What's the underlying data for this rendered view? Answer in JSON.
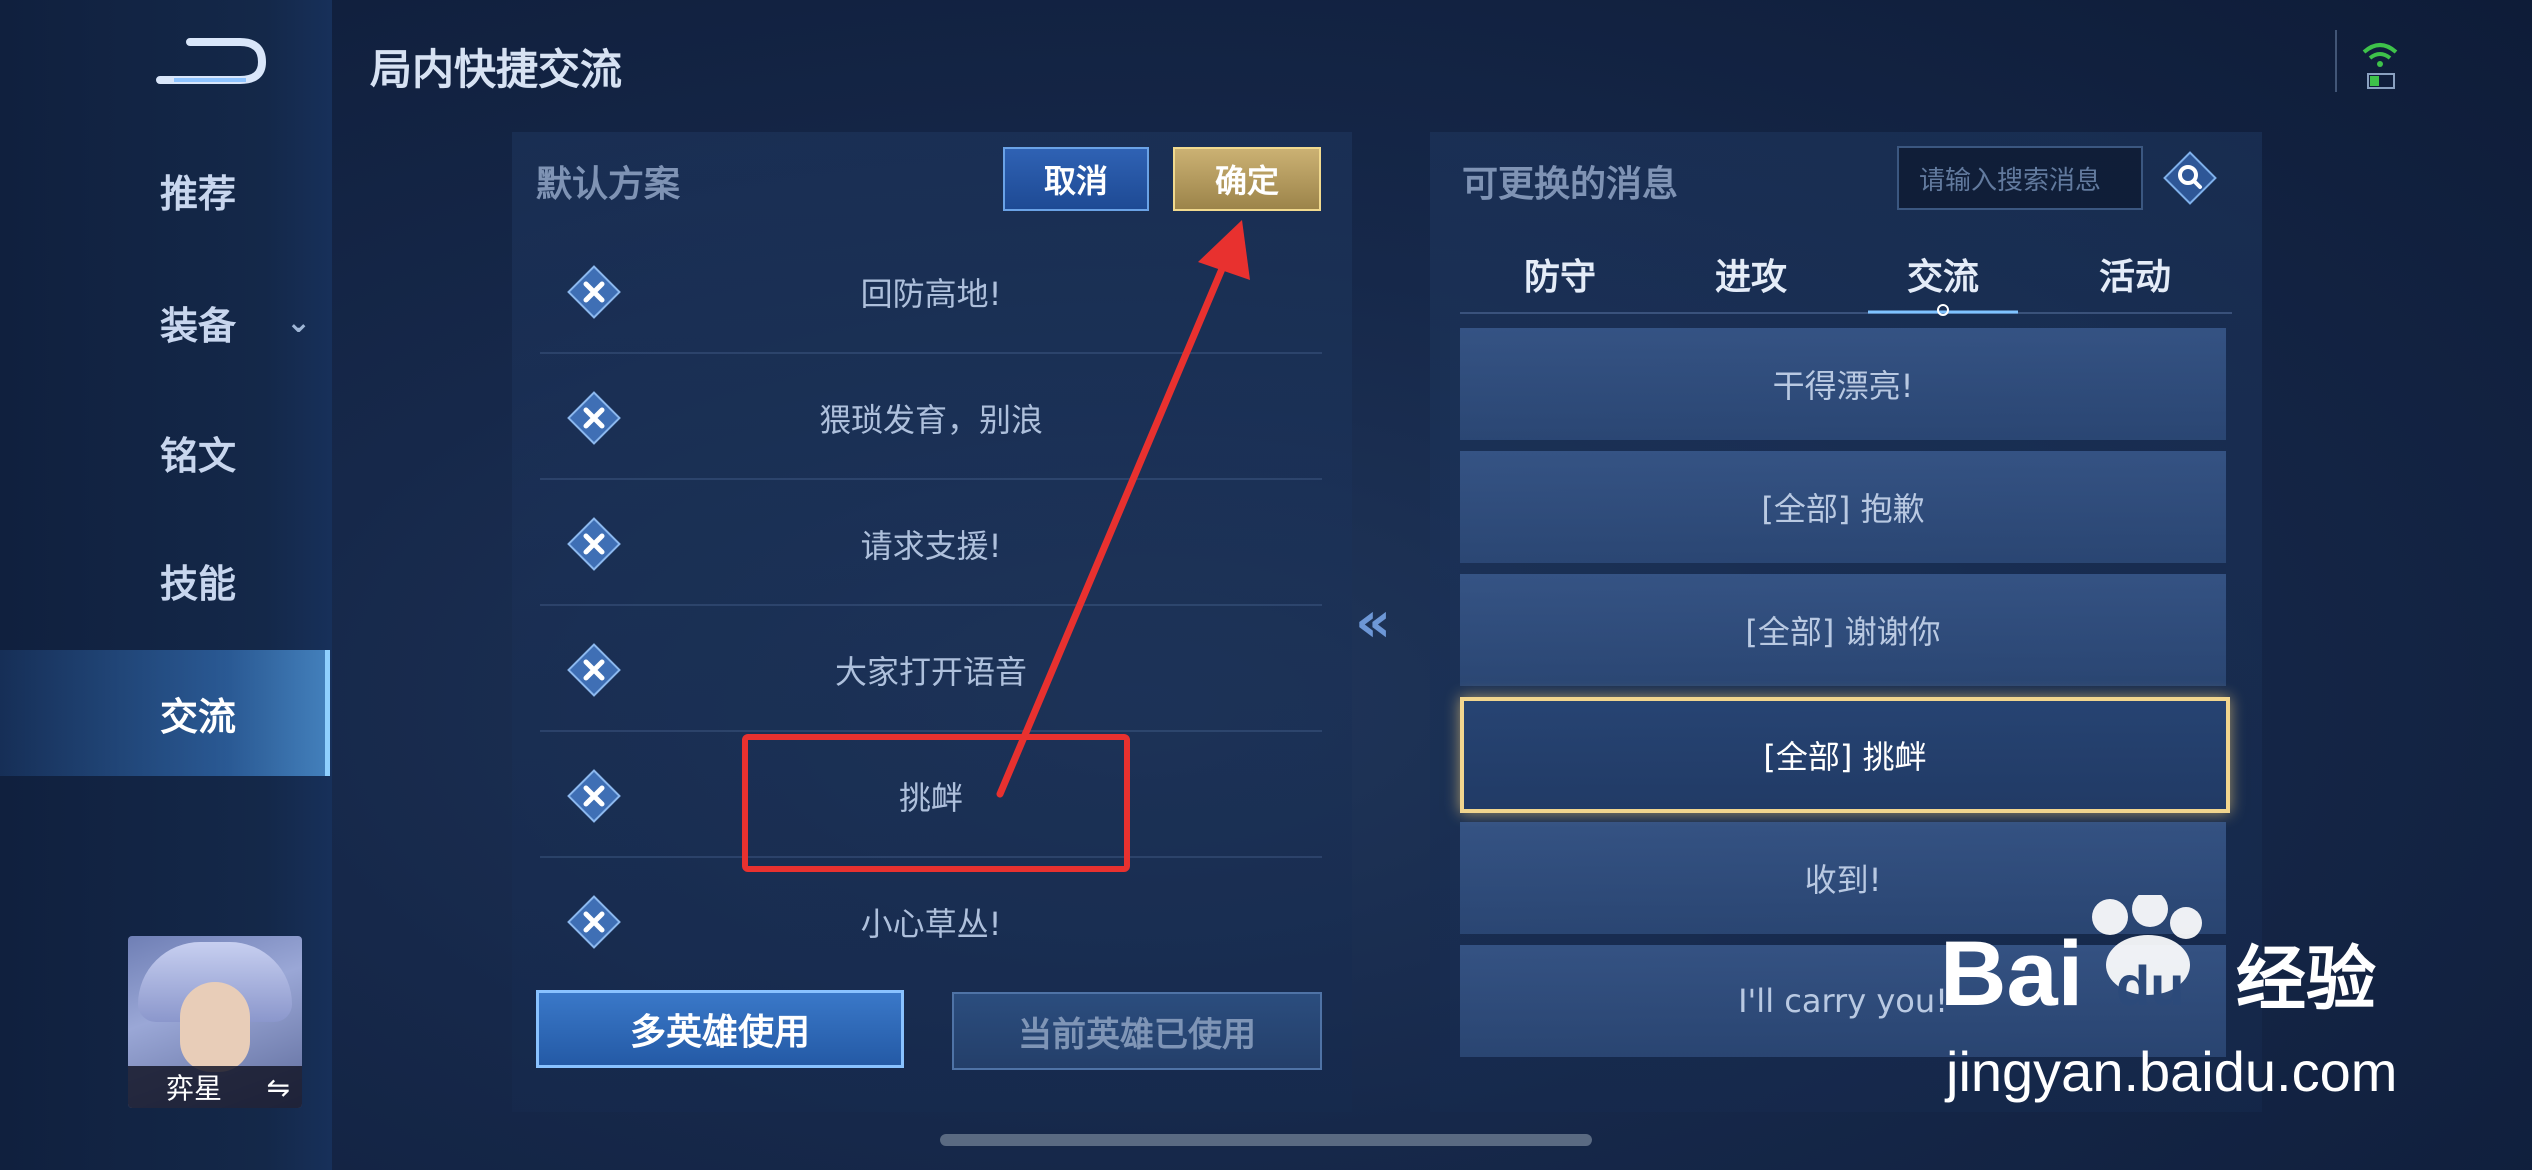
{
  "header": {
    "title": "局内快捷交流"
  },
  "sidebar": {
    "items": [
      {
        "label": "推荐"
      },
      {
        "label": "装备"
      },
      {
        "label": "铭文"
      },
      {
        "label": "技能"
      },
      {
        "label": "交流"
      }
    ],
    "hero_name": "弈星",
    "hero_swap_glyph": "⇋"
  },
  "left_panel": {
    "heading": "默认方案",
    "cancel_label": "取消",
    "confirm_label": "确定",
    "messages": [
      {
        "text": "回防高地!"
      },
      {
        "text": "猥琐发育，别浪"
      },
      {
        "text": "请求支援!"
      },
      {
        "text": "大家打开语音"
      },
      {
        "text": "挑衅"
      },
      {
        "text": "小心草丛!"
      }
    ],
    "multi_hero_label": "多英雄使用",
    "current_hero_label": "当前英雄已使用"
  },
  "transfer_glyph": "«",
  "right_panel": {
    "heading": "可更换的消息",
    "search_placeholder": "请输入搜索消息",
    "tabs": [
      {
        "label": "防守"
      },
      {
        "label": "进攻"
      },
      {
        "label": "交流"
      },
      {
        "label": "活动"
      }
    ],
    "active_tab": "交流",
    "options": [
      {
        "text": "干得漂亮!"
      },
      {
        "text": "[全部] 抱歉"
      },
      {
        "text": "[全部] 谢谢你"
      },
      {
        "text": "[全部] 挑衅"
      },
      {
        "text": "收到!"
      },
      {
        "text": "I'll carry you!"
      }
    ],
    "selected_option": "[全部] 挑衅"
  },
  "watermark": {
    "brand": "Bai",
    "brand_du": "du",
    "suffix": "经验",
    "url": "jingyan.baidu.com"
  },
  "colors": {
    "accent_gold": "#f1d58e",
    "annotation_red": "#e8312f",
    "accent_blue": "#3a78c8"
  }
}
